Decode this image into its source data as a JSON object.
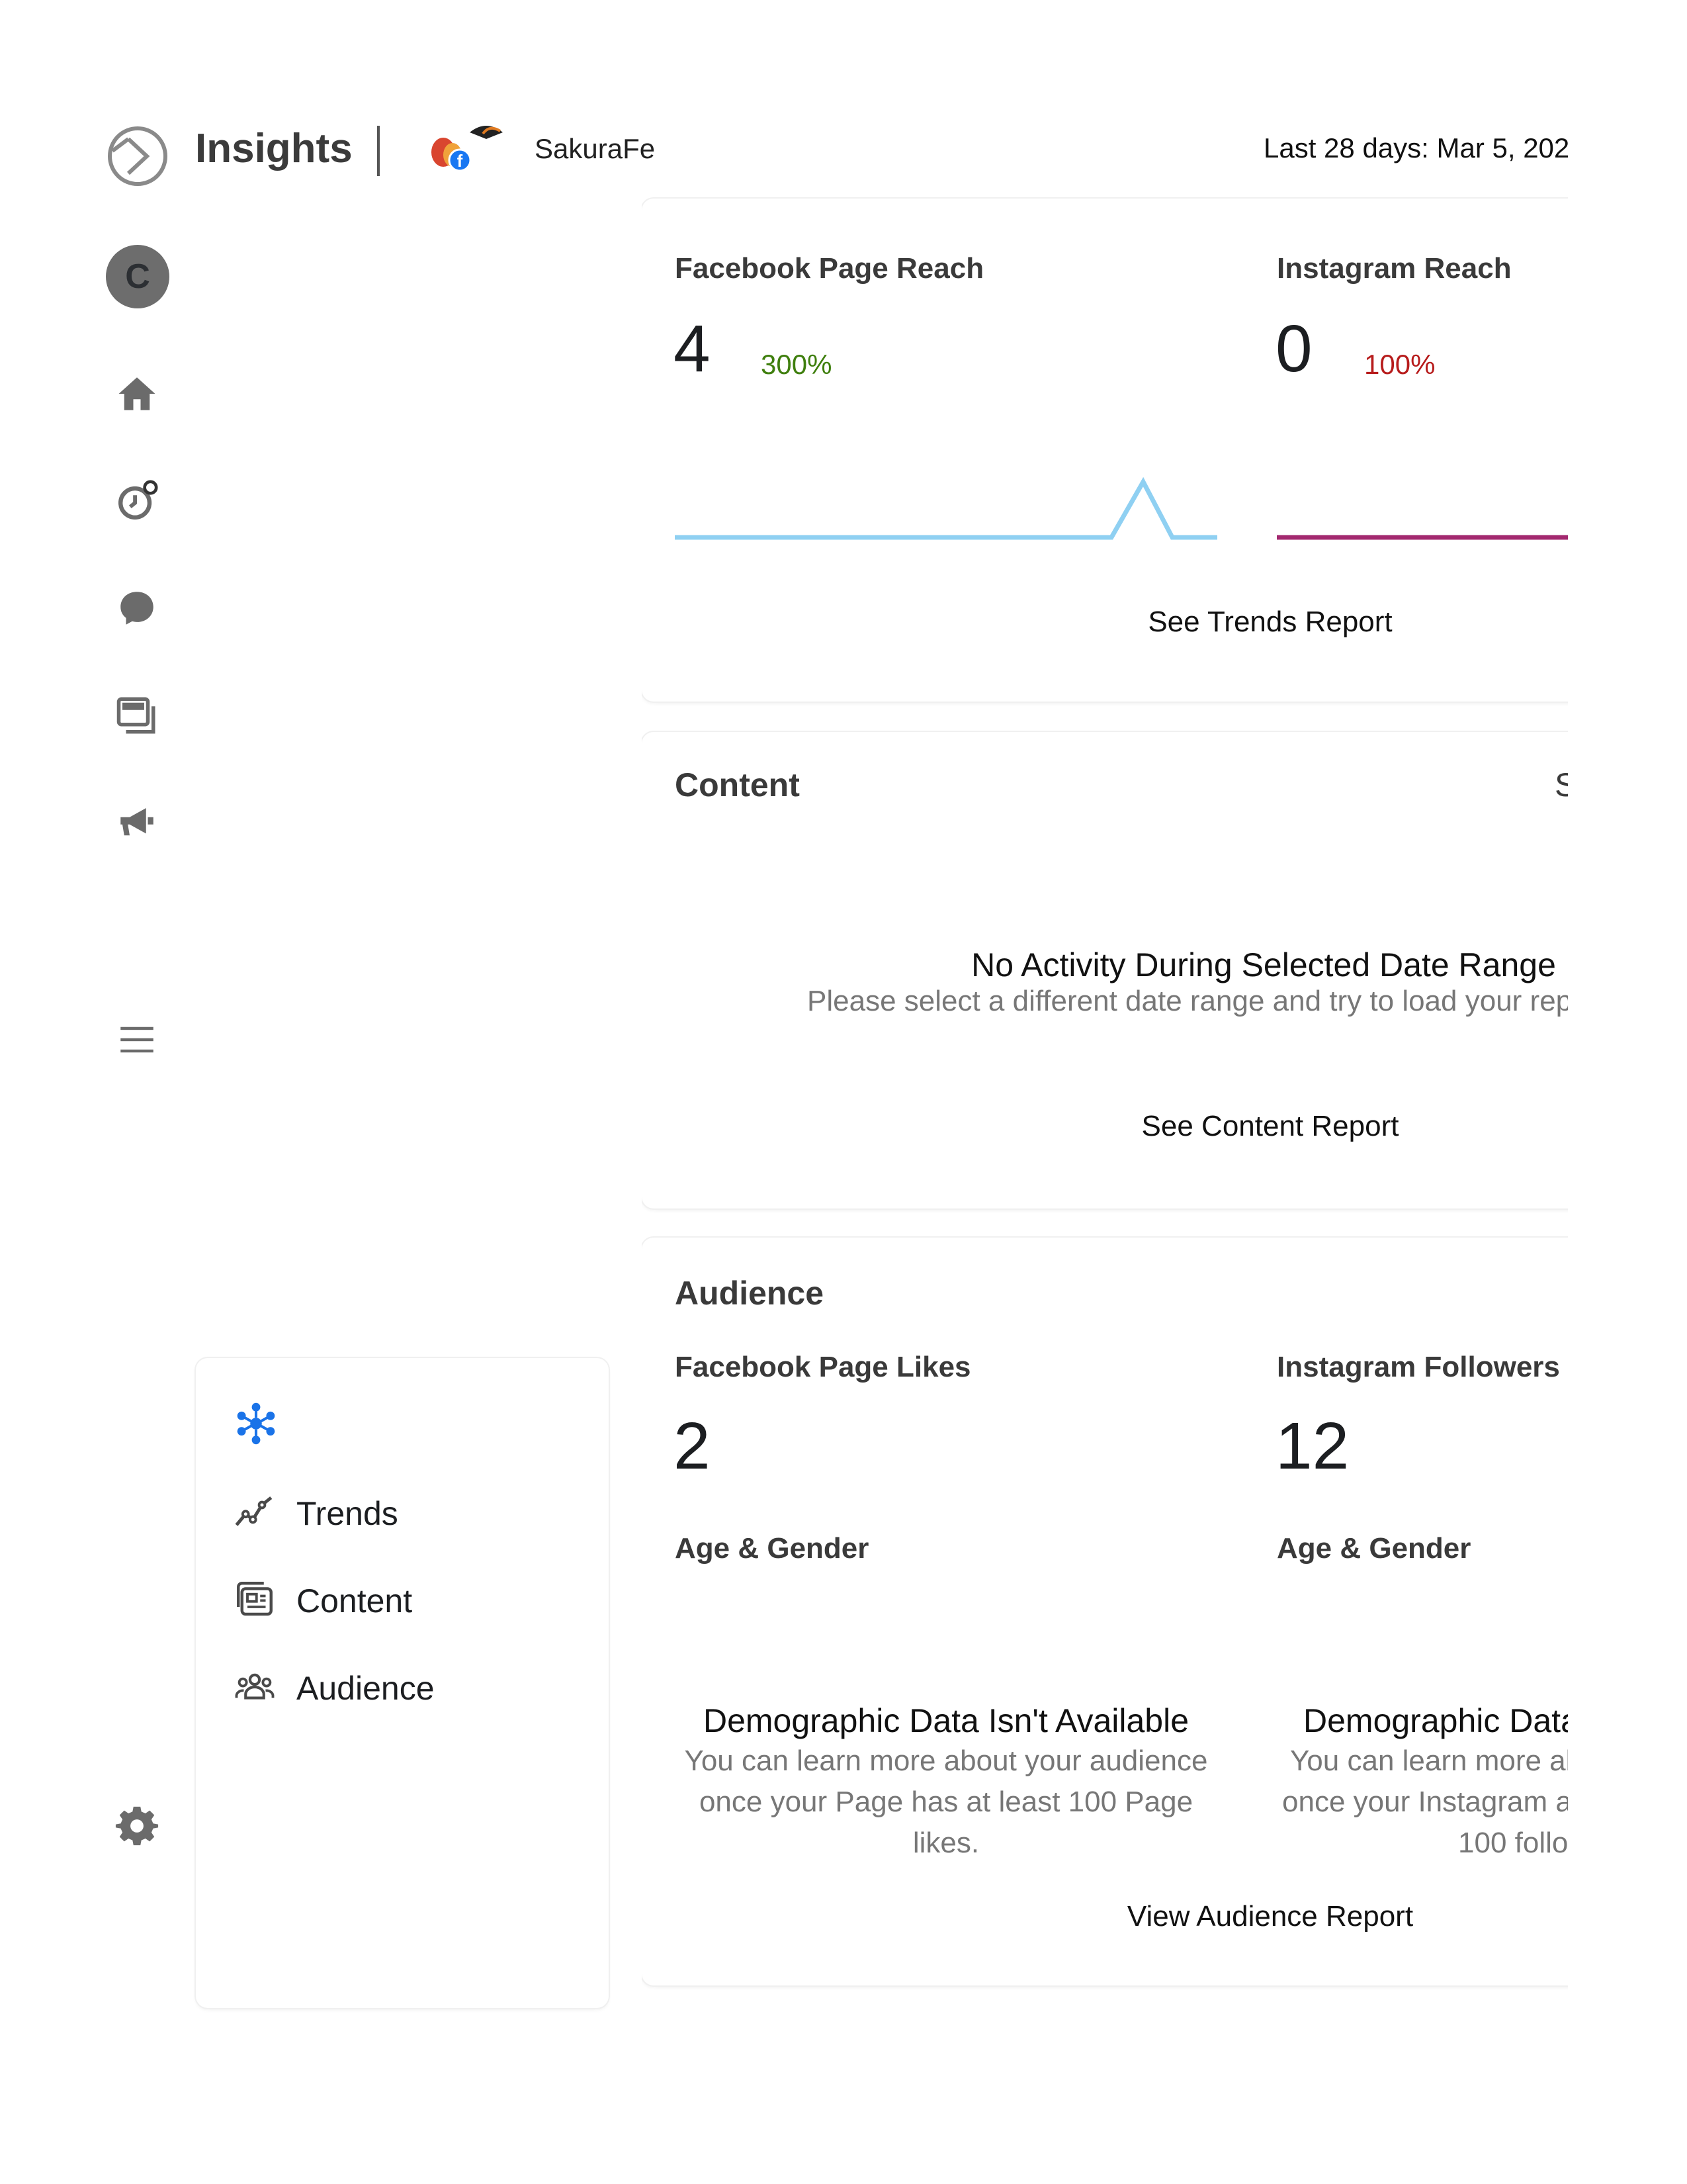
{
  "header": {
    "app_title": "Insights",
    "page_name": "SakuraFe",
    "date_range": "Last 28 days: Mar 5, 202"
  },
  "rail": {
    "avatar_letter": "C",
    "icons": [
      "home-icon",
      "planner-icon",
      "inbox-icon",
      "content-icon",
      "ads-icon",
      "menu-icon",
      "settings-icon"
    ]
  },
  "reach": {
    "fb_label": "Facebook Page Reach",
    "fb_value": "4",
    "fb_change": "300%",
    "ig_label": "Instagram Reach",
    "ig_value": "0",
    "ig_change": "100%",
    "link": "See Trends Report"
  },
  "content": {
    "title": "Content",
    "cut_text": "S",
    "empty_title": "No Activity During Selected Date Range",
    "empty_sub": "Please select a different date range and try to load your repo",
    "link": "See Content Report"
  },
  "audience": {
    "title": "Audience",
    "fb_label": "Facebook Page Likes",
    "fb_value": "2",
    "ig_label": "Instagram Followers",
    "ig_value": "12",
    "age_gender_label": "Age & Gender",
    "fb_empty_title": "Demographic Data Isn't Available",
    "fb_empty_sub_1": "You can learn more about your audience",
    "fb_empty_sub_2": "once your Page has at least 100 Page",
    "fb_empty_sub_3": "likes.",
    "ig_empty_title": "Demographic Data",
    "ig_empty_sub_1": "You can learn more ab",
    "ig_empty_sub_2": "once your Instagram a",
    "ig_empty_sub_3": "100 follo",
    "link": "View Audience Report"
  },
  "side_menu": {
    "items": [
      {
        "label": "Trends"
      },
      {
        "label": "Content"
      },
      {
        "label": "Audience"
      }
    ]
  },
  "colors": {
    "fb_line": "#8fd0f2",
    "ig_line": "#a3286f",
    "accent_blue": "#1a73e8",
    "up": "#3f7f0e",
    "down": "#b71c1c"
  }
}
